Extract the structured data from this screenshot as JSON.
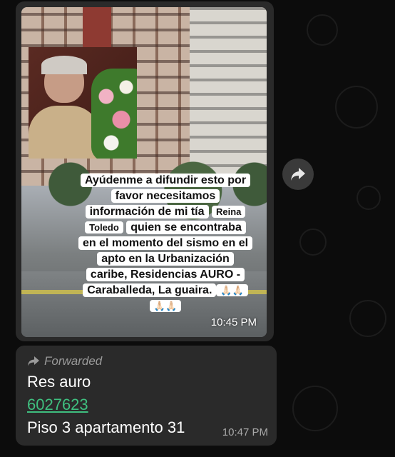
{
  "image_message": {
    "caption": {
      "line1": "Ayúdenme a difundir esto por",
      "line2": "favor necesitamos",
      "line3a": "información de mi tía",
      "line3b": "Reina",
      "line4a": "Toledo",
      "line4b": "quien se encontraba",
      "line5": "en el momento del sismo en el",
      "line6": "apto en la Urbanización",
      "line7": "caribe, Residencias AURO -",
      "line8": "Caraballeda, La guaira.",
      "emoji1": "🙏🏻🙏🏻",
      "emoji2": "🙏🏻🙏🏻"
    },
    "time": "10:45 PM"
  },
  "text_message": {
    "forwarded_label": "Forwarded",
    "line1": "Res auro",
    "phone": "6027623",
    "line3": "Piso 3 apartamento 31",
    "time": "10:47 PM"
  },
  "colors": {
    "background": "#0c0c0c",
    "bubble": "#2a2a2a",
    "link": "#3fbf7f"
  },
  "icons": {
    "forward_button": "share-forward-icon",
    "forwarded_marker": "forward-arrow-icon"
  }
}
